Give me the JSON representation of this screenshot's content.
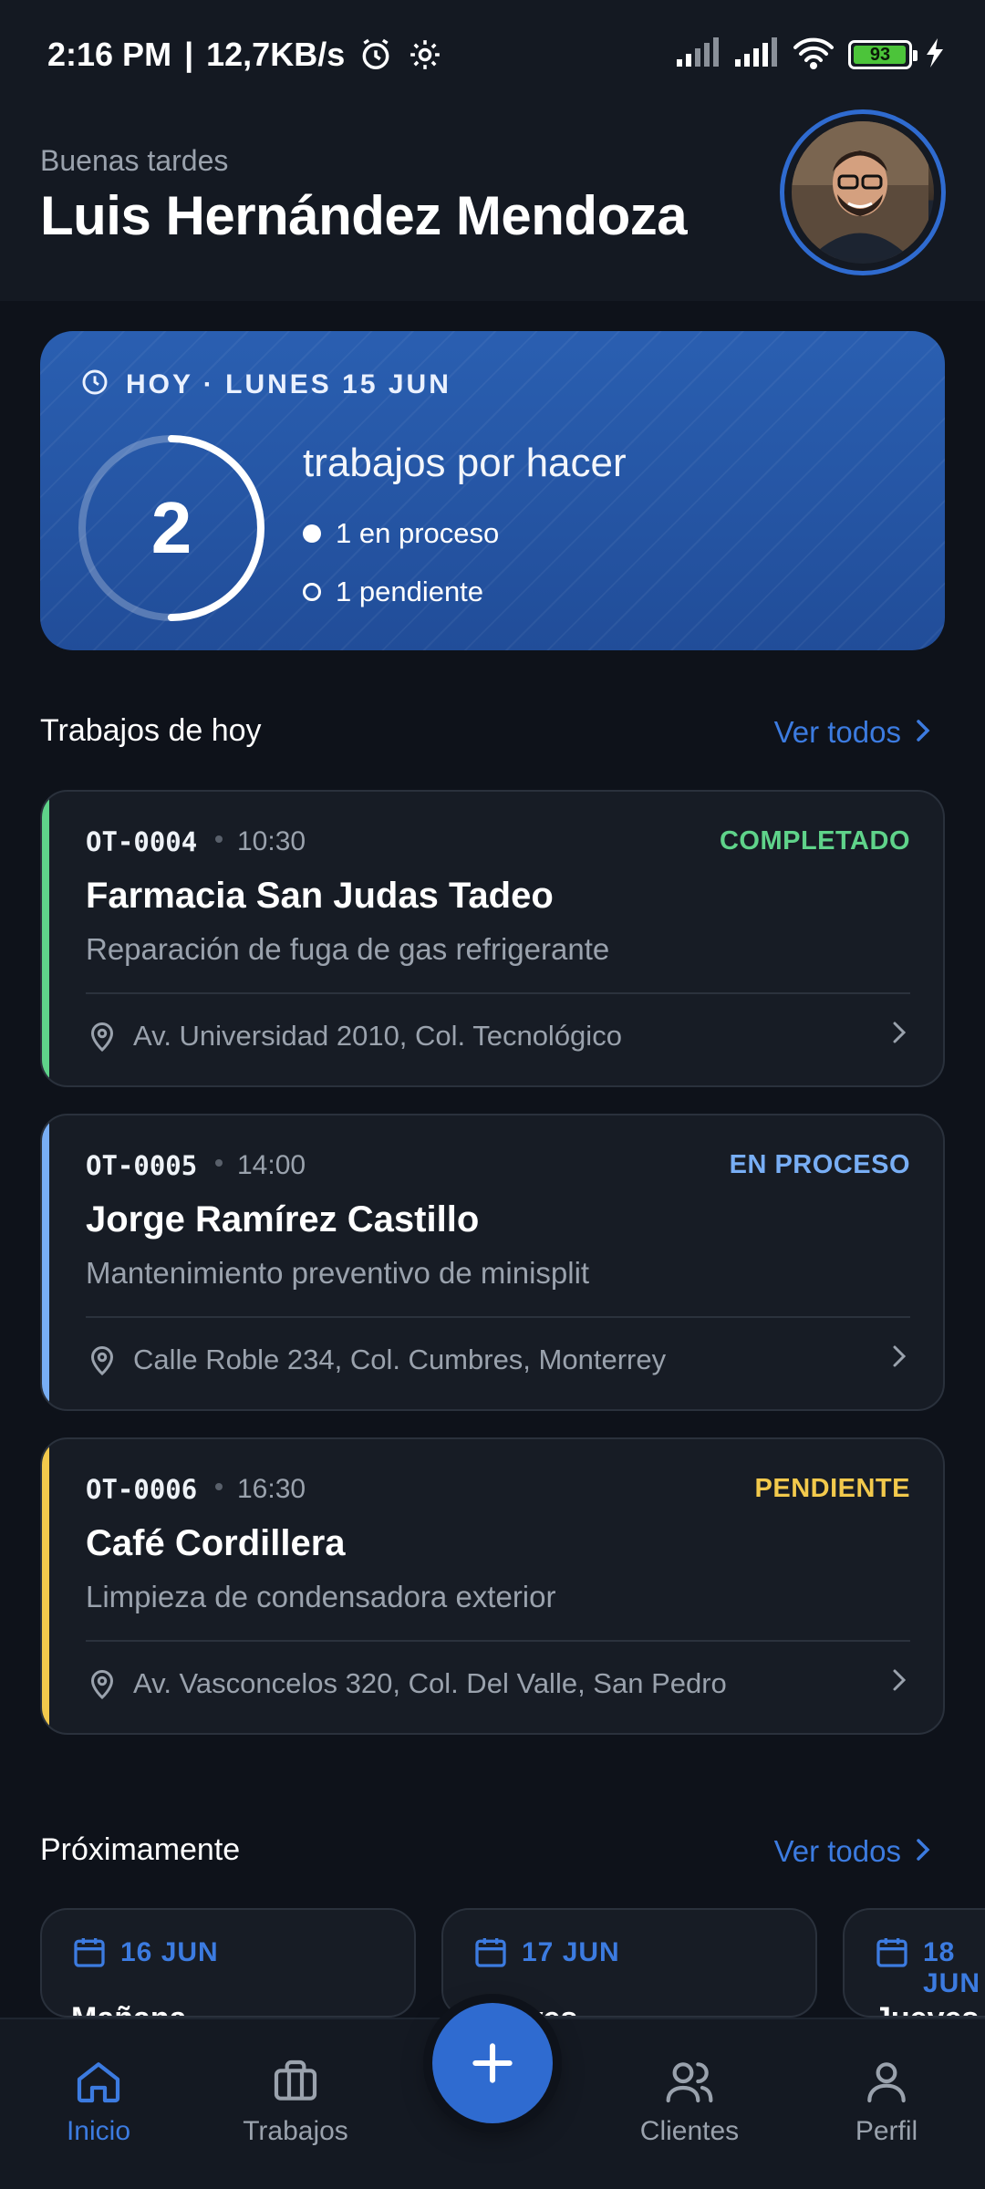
{
  "status_bar": {
    "time": "2:16 PM",
    "speed": "12,7KB/s",
    "battery_level": "93",
    "icons": [
      "alarm-icon",
      "gear-icon",
      "signal-icon",
      "signal-icon",
      "wifi-icon",
      "battery-icon",
      "charging-icon"
    ]
  },
  "header": {
    "greeting": "Buenas tardes",
    "user_name": "Luis Hernández Mendoza"
  },
  "today_card": {
    "date_label": "HOY · LUNES 15 JUN",
    "count": "2",
    "title": "trabajos por hacer",
    "in_progress": "1 en proceso",
    "pending": "1 pendiente",
    "progress_fraction": 0.5
  },
  "today_section": {
    "title": "Trabajos de hoy",
    "see_all": "Ver todos"
  },
  "jobs": [
    {
      "code": "OT-0004",
      "time": "10:30",
      "status": "COMPLETADO",
      "status_color": "#5fd38a",
      "client": "Farmacia San Judas Tadeo",
      "description": "Reparación de fuga de gas refrigerante",
      "address": "Av. Universidad 2010, Col. Tecnológico"
    },
    {
      "code": "OT-0005",
      "time": "14:00",
      "status": "EN PROCESO",
      "status_color": "#78aef5",
      "client": "Jorge Ramírez Castillo",
      "description": "Mantenimiento preventivo de minisplit",
      "address": "Calle Roble 234, Col. Cumbres, Monterrey"
    },
    {
      "code": "OT-0006",
      "time": "16:30",
      "status": "PENDIENTE",
      "status_color": "#f2c94c",
      "client": "Café Cordillera",
      "description": "Limpieza de condensadora exterior",
      "address": "Av. Vasconcelos 320, Col. Del Valle, San Pedro"
    }
  ],
  "upcoming_section": {
    "title": "Próximamente",
    "see_all": "Ver todos",
    "cards": [
      {
        "date": "16 JUN",
        "label": "Mañana"
      },
      {
        "date": "17 JUN",
        "label": "Jueves"
      },
      {
        "date": "18 JUN",
        "label": "Jueves"
      }
    ]
  },
  "bottom_nav": {
    "items": [
      {
        "label": "Inicio",
        "icon": "home-icon",
        "active": true
      },
      {
        "label": "Trabajos",
        "icon": "briefcase-icon",
        "active": false
      },
      {
        "label": "Clientes",
        "icon": "users-icon",
        "active": false
      },
      {
        "label": "Perfil",
        "icon": "user-icon",
        "active": false
      }
    ],
    "fab_icon": "plus-icon"
  },
  "colors": {
    "accent": "#2f6bd0",
    "link": "#3c7be0",
    "background": "#0e121a",
    "card": "#171c25"
  }
}
